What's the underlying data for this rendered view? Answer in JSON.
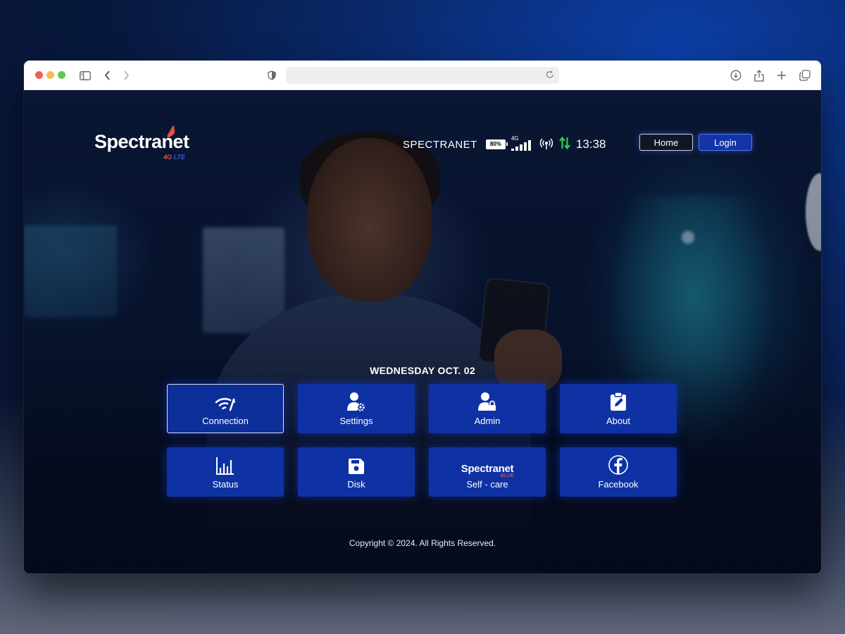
{
  "browser": {
    "toolbar_icons": [
      "sidebar-icon",
      "back-icon",
      "forward-icon",
      "shield-icon",
      "reload-icon",
      "download-icon",
      "share-icon",
      "new-tab-icon",
      "tabs-overview-icon"
    ],
    "address": ""
  },
  "header": {
    "logo_text": "Spectranet",
    "logo_sub": "4G",
    "logo_sub_lte": "LTE"
  },
  "status": {
    "network_name": "SPECTRANET",
    "battery": "80%",
    "network_type": "4G",
    "signal_bars": 4,
    "time": "13:38",
    "data_arrows_color": "#2fd14a"
  },
  "nav": {
    "home_label": "Home",
    "login_label": "Login"
  },
  "date_label": "WEDNESDAY OCT. 02",
  "tiles": [
    {
      "label": "Connection",
      "icon": "wifi-icon"
    },
    {
      "label": "Settings",
      "icon": "user-gear-icon"
    },
    {
      "label": "Admin",
      "icon": "user-lock-icon"
    },
    {
      "label": "About",
      "icon": "clipboard-edit-icon"
    },
    {
      "label": "Status",
      "icon": "bar-chart-icon"
    },
    {
      "label": "Disk",
      "icon": "floppy-disk-icon"
    },
    {
      "label": "Self - care",
      "icon": "spectranet-logo-icon",
      "logo_text": "Spectranet",
      "logo_sub": "4G LTE"
    },
    {
      "label": "Facebook",
      "icon": "facebook-icon"
    }
  ],
  "footer": {
    "copyright": "Copyright © 2024. All Rights Reserved."
  },
  "colors": {
    "tile_bg": "#0e32a3",
    "login_bg": "#1434a8",
    "brand_red": "#e2514a"
  }
}
